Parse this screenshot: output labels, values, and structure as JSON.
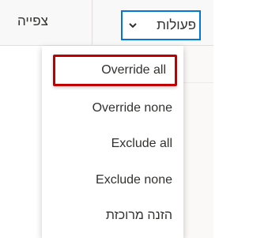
{
  "toolbar": {
    "view_label": "צפייה",
    "actions_label": "פעולות"
  },
  "menu": {
    "items": [
      {
        "label": "Override all",
        "highlighted": true
      },
      {
        "label": "Override none",
        "highlighted": false
      },
      {
        "label": "Exclude all",
        "highlighted": false
      },
      {
        "label": "Exclude none",
        "highlighted": false
      },
      {
        "label": "הזנה מרוכזת",
        "highlighted": false
      }
    ]
  },
  "colors": {
    "accent": "#0078d4",
    "highlight_border": "#c00000",
    "text": "#323130",
    "toolbar_bg": "#f8f8f8"
  },
  "icons": {
    "actions_chevron": "chevron-down-icon"
  }
}
